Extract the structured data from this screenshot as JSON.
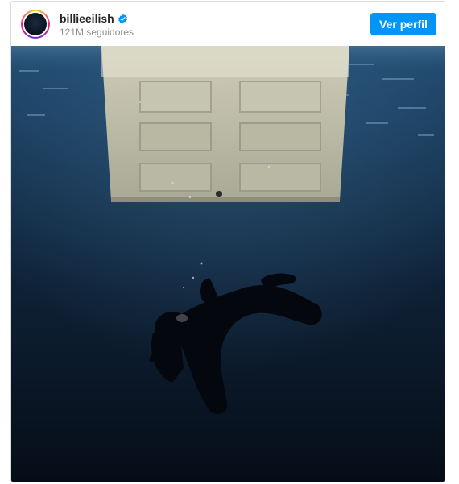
{
  "post": {
    "username": "billieeilish",
    "followers": "121M seguidores",
    "view_profile_label": "Ver perfil"
  },
  "icons": {
    "verified": "verified-badge-icon",
    "avatar": "profile-avatar"
  },
  "colors": {
    "accent": "#0095f6",
    "water_top": "#1a3a5c",
    "water_bottom": "#07101b"
  }
}
